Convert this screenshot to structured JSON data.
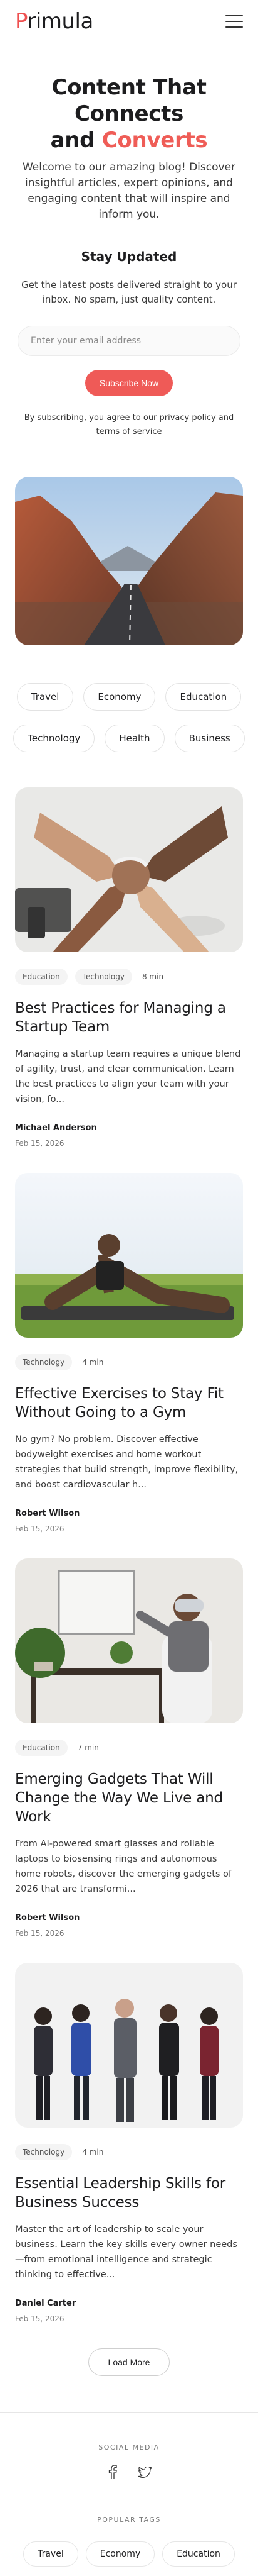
{
  "header": {
    "logo_first": "P",
    "logo_rest": "rimula"
  },
  "hero": {
    "title_line1": "Content That Connects",
    "title_and": "and",
    "title_accent": "Converts",
    "intro": "Welcome to our amazing blog! Discover insightful articles, expert opinions, and engaging content that will inspire and inform you.",
    "stay_updated": "Stay Updated",
    "sub": "Get the latest posts delivered straight to your inbox. No spam, just quality content.",
    "email_placeholder": "Enter your email address",
    "subscribe_label": "Subscribe Now",
    "privacy": "By subscribing, you agree to our privacy policy and terms of service"
  },
  "tags": {
    "row1": [
      "Travel",
      "Economy",
      "Education"
    ],
    "row2": [
      "Technology",
      "Health",
      "Business"
    ]
  },
  "posts": [
    {
      "category": "Education",
      "category2": "Technology",
      "read_time": "8 min",
      "title": "Best Practices for Managing a Startup Team",
      "excerpt": "Managing a startup team requires a unique blend of agility, trust, and clear communication. Learn the best practices to align your team with your vision, fo...",
      "author": "Michael Anderson",
      "date": "Feb 15, 2026"
    },
    {
      "category": "Technology",
      "read_time": "4 min",
      "title": "Effective Exercises to Stay Fit Without Going to a Gym",
      "excerpt": "No gym? No problem. Discover effective bodyweight exercises and home workout strategies that build strength, improve flexibility, and boost cardiovascular h...",
      "author": "Robert Wilson",
      "date": "Feb 15, 2026"
    },
    {
      "category": "Education",
      "read_time": "7 min",
      "title": "Emerging Gadgets That Will Change the Way We Live and Work",
      "excerpt": "From AI-powered smart glasses and rollable laptops to biosensing rings and autonomous home robots, discover the emerging gadgets of 2026 that are transformi...",
      "author": "Robert Wilson",
      "date": "Feb 15, 2026"
    },
    {
      "category": "Technology",
      "read_time": "4 min",
      "title": "Essential Leadership Skills for Business Success",
      "excerpt": "Master the art of leadership to scale your business. Learn the key skills every owner needs—from emotional intelligence and strategic thinking to effective...",
      "author": "Daniel Carter",
      "date": "Feb 15, 2026"
    }
  ],
  "load_more_label": "Load More",
  "footer": {
    "social_heading": "SOCIAL MEDIA",
    "social_icons": [
      "facebook-icon",
      "twitter-icon"
    ],
    "popular_heading": "POPULAR TAGS",
    "popular_tags": [
      "Travel",
      "Economy",
      "Education"
    ]
  },
  "colors": {
    "accent": "#ef5a57",
    "text": "#1d1d1f"
  }
}
